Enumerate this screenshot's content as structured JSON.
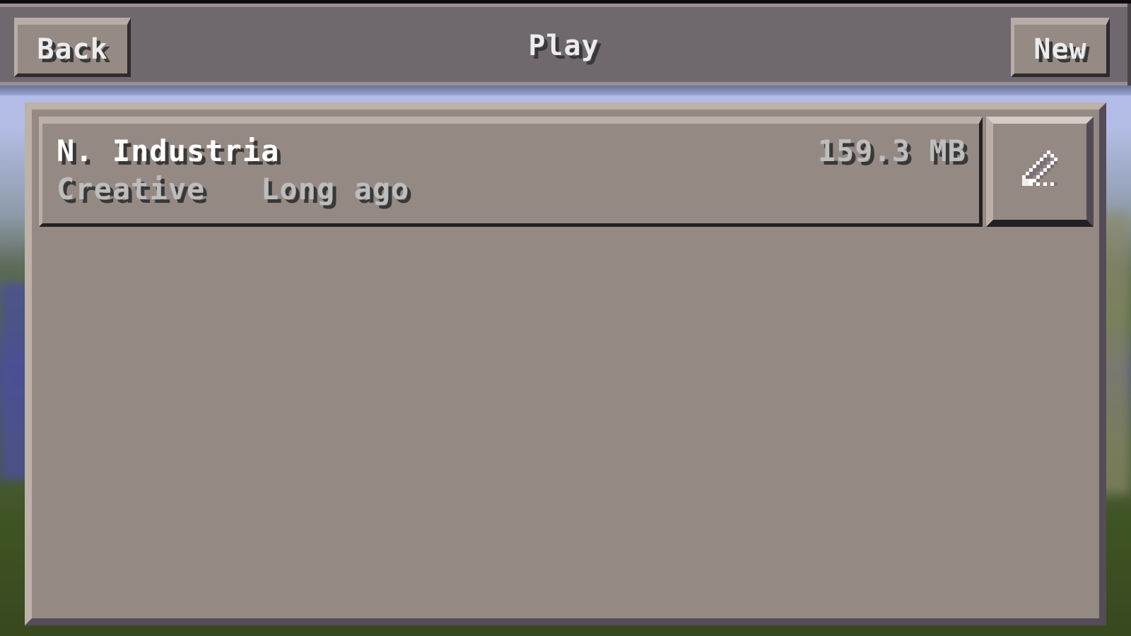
{
  "header": {
    "title": "Play",
    "back_label": "Back",
    "new_label": "New"
  },
  "worlds": [
    {
      "name": "N. Industria",
      "size": "159.3 MB",
      "mode": "Creative",
      "last_played": "Long ago",
      "edit_icon": "pencil-icon"
    }
  ]
}
